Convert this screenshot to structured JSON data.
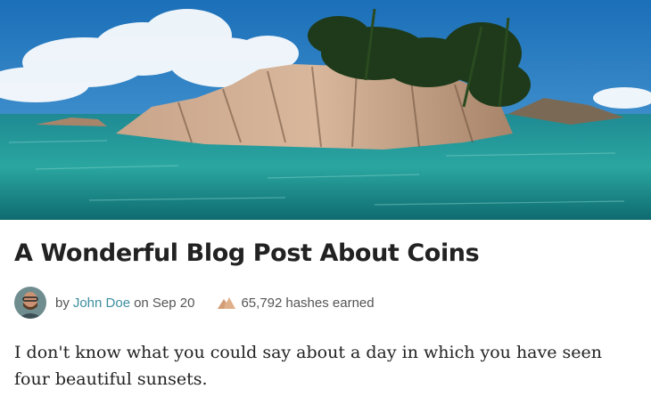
{
  "post": {
    "title": "A Wonderful Blog Post About Coins",
    "meta": {
      "by": "by",
      "author": "John Doe",
      "on_date": "on Sep 20",
      "hashes_count": "65,792",
      "hashes_label": "hashes earned"
    },
    "body": "I don't know what you could say about a day in which you have seen four beautiful sunsets."
  },
  "colors": {
    "author_link": "#3d8fa0",
    "hash_icon": "#e0b08a"
  },
  "icons": {
    "hash": "mountain-icon"
  }
}
